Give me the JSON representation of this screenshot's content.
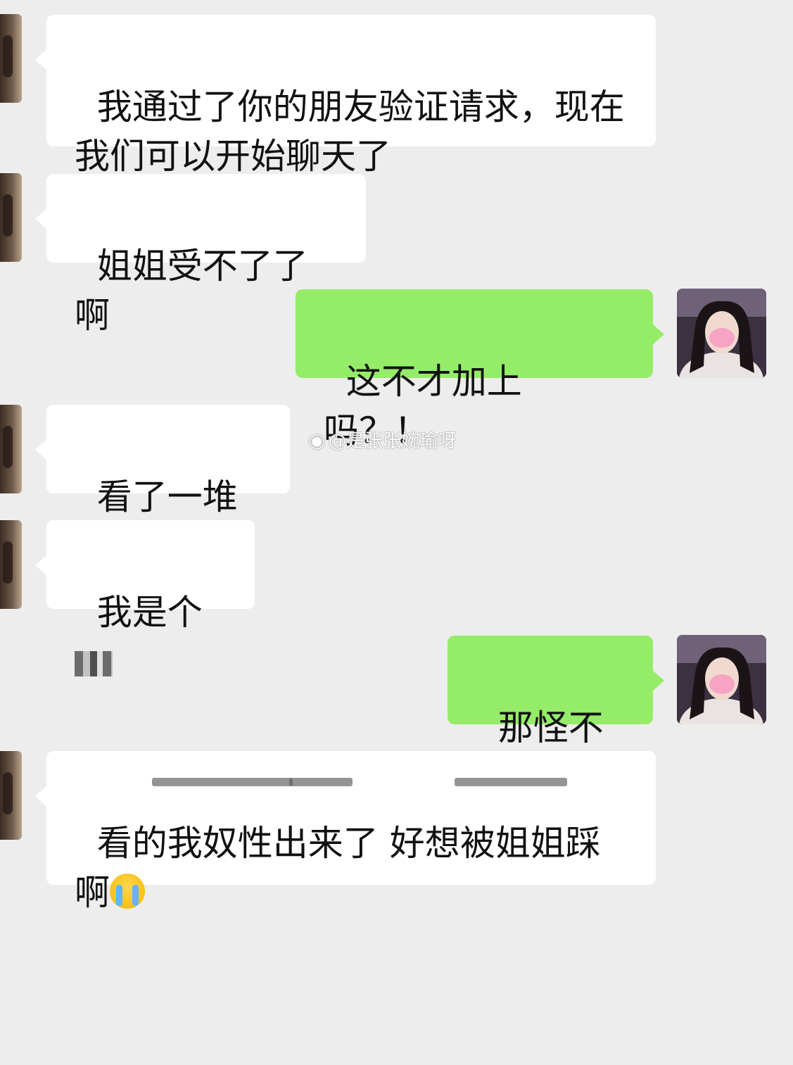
{
  "watermark": {
    "icon": "weibo-logo-icon",
    "text": "@是张张婉瑜呀"
  },
  "messages": [
    {
      "side": "left",
      "text": "我通过了你的朋友验证请求，现在\n我们可以开始聊天了"
    },
    {
      "side": "left",
      "text": "姐姐受不了了啊"
    },
    {
      "side": "right",
      "text": "这不才加上吗？！"
    },
    {
      "side": "left",
      "text": "看了一堆了"
    },
    {
      "side": "left",
      "text": "我是个"
    },
    {
      "side": "right",
      "text": "那怪不得"
    },
    {
      "side": "left",
      "text": "看的我奴性出来了 好想被姐姐踩\n啊"
    }
  ],
  "colors": {
    "background": "#ededed",
    "incoming_bubble": "#ffffff",
    "outgoing_bubble": "#95ec69"
  }
}
